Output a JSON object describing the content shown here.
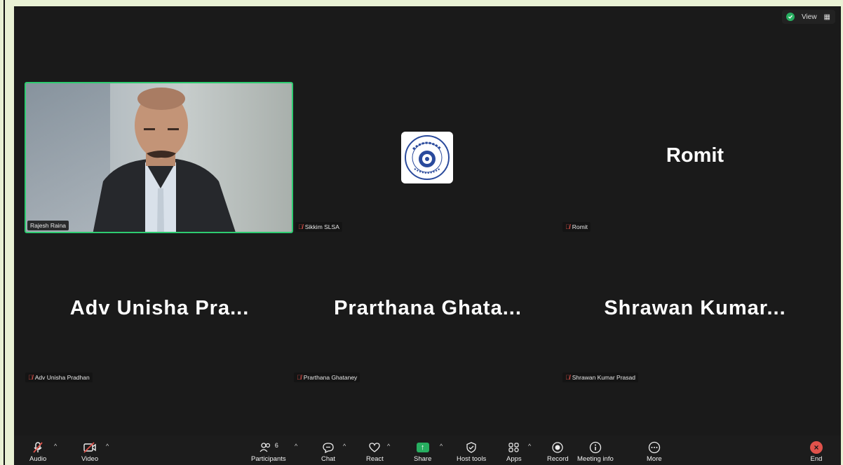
{
  "top_bar": {
    "view_label": "View"
  },
  "tiles": [
    {
      "name": "Rajesh Raina",
      "display_name": ""
    },
    {
      "name": "Sikkim SLSA",
      "display_name": ""
    },
    {
      "name": "Romit",
      "display_name": "Romit"
    },
    {
      "name": "Adv Unisha Pradhan",
      "display_name": "Adv Unisha Pra..."
    },
    {
      "name": "Prarthana Ghataney",
      "display_name": "Prarthana Ghata..."
    },
    {
      "name": "Shrawan Kumar Prasad",
      "display_name": "Shrawan Kumar..."
    }
  ],
  "toolbar": {
    "audio": "Audio",
    "video": "Video",
    "participants": "Participants",
    "participants_count": "6",
    "chat": "Chat",
    "react": "React",
    "share": "Share",
    "host_tools": "Host tools",
    "apps": "Apps",
    "record": "Record",
    "meeting_info": "Meeting info",
    "more": "More",
    "end": "End"
  },
  "colors": {
    "active_speaker": "#2ecc71",
    "muted": "#e0524b",
    "share": "#27ae60",
    "end": "#e0524b"
  }
}
